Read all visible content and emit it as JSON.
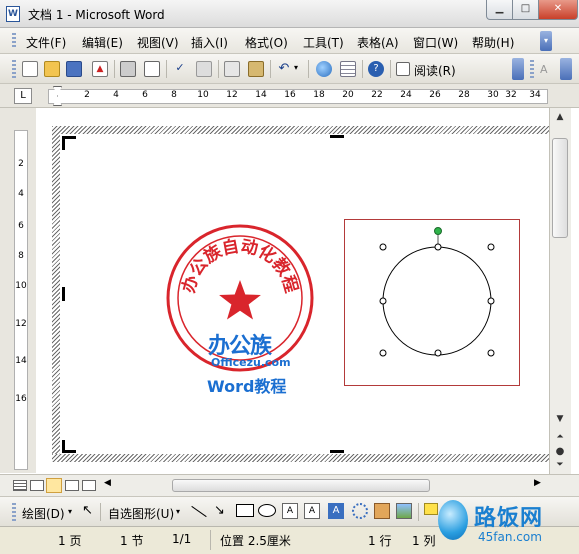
{
  "window": {
    "title": "文档 1 - Microsoft Word",
    "app_icon_text": "W"
  },
  "menu": [
    "文件(F)",
    "编辑(E)",
    "视图(V)",
    "插入(I)",
    "格式(O)",
    "工具(T)",
    "表格(A)",
    "窗口(W)",
    "帮助(H)"
  ],
  "toolbar": {
    "read_label": "阅读(R)",
    "font_size_glyph": "A"
  },
  "ruler": {
    "corner": "L",
    "h_ticks": [
      "2",
      "4",
      "6",
      "8",
      "10",
      "12",
      "14",
      "16",
      "18",
      "20",
      "22",
      "24",
      "26",
      "28",
      "30",
      "32",
      "34"
    ],
    "v_ticks": [
      "2",
      "4",
      "6",
      "8",
      "10",
      "12",
      "14",
      "16"
    ]
  },
  "seal": {
    "arc_text": "办公族自动化教程",
    "logo_brand": "办公族",
    "logo_url": "Officezu.com",
    "logo_subtitle": "Word教程"
  },
  "drawing_toolbar": {
    "draw_label": "绘图(D)",
    "autoshapes_label": "自选图形(U)"
  },
  "status": {
    "page": "1 页",
    "section": "1 节",
    "page_of": "1/1",
    "position": "位置 2.5厘米",
    "line": "1 行",
    "column": "1 列"
  },
  "watermark": {
    "site_cn": "路饭网",
    "site_url": "45fan.com"
  },
  "colors": {
    "seal_red": "#d9252c",
    "logo_blue": "#1b6fd1",
    "handle_green": "#2fb34a"
  }
}
